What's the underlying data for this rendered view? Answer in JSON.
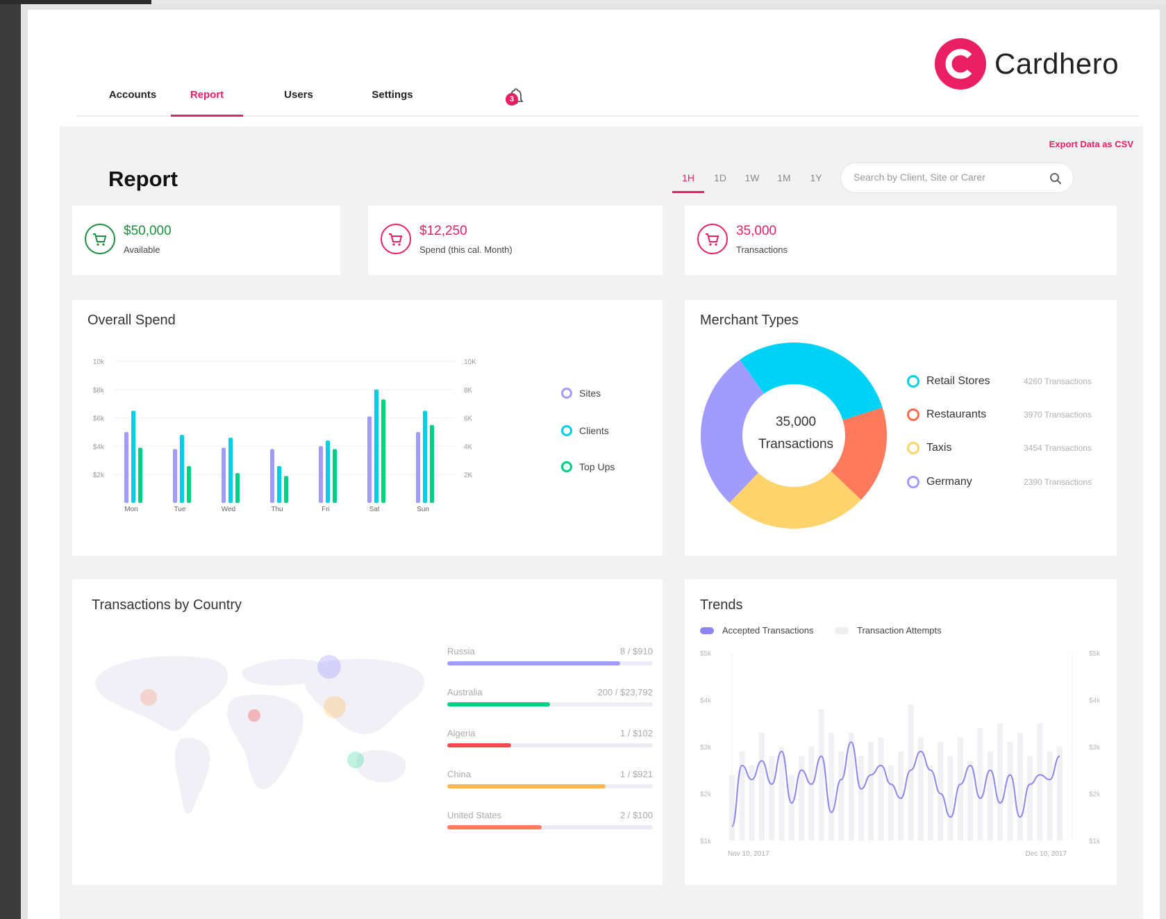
{
  "brand": {
    "name": "Cardhero",
    "accent": "#e91e63"
  },
  "nav": {
    "tabs": [
      {
        "label": "Accounts",
        "active": false
      },
      {
        "label": "Report",
        "active": true
      },
      {
        "label": "Users",
        "active": false
      },
      {
        "label": "Settings",
        "active": false
      }
    ],
    "notification_count": "3"
  },
  "page": {
    "title": "Report",
    "export_label": "Export Data as CSV",
    "timeframes": [
      {
        "label": "1H",
        "active": true
      },
      {
        "label": "1D",
        "active": false
      },
      {
        "label": "1W",
        "active": false
      },
      {
        "label": "1M",
        "active": false
      },
      {
        "label": "1Y",
        "active": false
      }
    ],
    "search_placeholder": "Search by Client, Site or Carer"
  },
  "stats": [
    {
      "value": "$50,000",
      "label": "Available",
      "color": "#1e8e3e",
      "icon": "cart-icon"
    },
    {
      "value": "$12,250",
      "label": "Spend (this cal. Month)",
      "color": "#e91e63",
      "icon": "cart-icon"
    },
    {
      "value": "35,000",
      "label": "Transactions",
      "color": "#e91e63",
      "icon": "cart-icon"
    }
  ],
  "overall_spend": {
    "title": "Overall Spend",
    "chart_data": {
      "type": "bar",
      "categories": [
        "Mon",
        "Tue",
        "Wed",
        "Thu",
        "Fri",
        "Sat",
        "Sun"
      ],
      "series": [
        {
          "name": "Sites",
          "color": "#a29bfe",
          "values": [
            5.0,
            3.8,
            3.9,
            3.8,
            4.0,
            6.1,
            5.0
          ]
        },
        {
          "name": "Clients",
          "color": "#00cfe8",
          "values": [
            6.5,
            4.8,
            4.6,
            2.6,
            4.4,
            8.0,
            6.5
          ]
        },
        {
          "name": "Top Ups",
          "color": "#00d084",
          "values": [
            3.9,
            2.6,
            2.1,
            1.9,
            3.8,
            7.3,
            5.5
          ]
        }
      ],
      "ylim": [
        0,
        10
      ],
      "y_ticks_left": [
        "$2k",
        "$4k",
        "$6k",
        "$8k",
        "10k"
      ],
      "y_ticks_right": [
        "2K",
        "4K",
        "6K",
        "8K",
        "10K"
      ],
      "grid": true
    }
  },
  "merchant_types": {
    "title": "Merchant Types",
    "center_value": "35,000",
    "center_label": "Transactions",
    "chart_data": {
      "type": "pie",
      "slices": [
        {
          "name": "Retail Stores",
          "color": "#00d2f5",
          "share": 0.3
        },
        {
          "name": "Restaurants",
          "color": "#ff7a5c",
          "share": 0.17
        },
        {
          "name": "Taxis",
          "color": "#ffd36b",
          "share": 0.25
        },
        {
          "name": "Germany",
          "color": "#a29bfe",
          "share": 0.28
        }
      ]
    },
    "legend": [
      {
        "name": "Retail Stores",
        "count": "4260 Transactions",
        "color": "#00cfe8"
      },
      {
        "name": "Restaurants",
        "count": "3970 Transactions",
        "color": "#ff6b4a"
      },
      {
        "name": "Taxis",
        "count": "3454 Transactions",
        "color": "#ffd36b"
      },
      {
        "name": "Germany",
        "count": "2390 Transactions",
        "color": "#a29bfe"
      }
    ]
  },
  "countries": {
    "title": "Transactions by Country",
    "rows": [
      {
        "name": "Russia",
        "value": "8 / $910",
        "fill": 0.84,
        "color": "#a29bfe"
      },
      {
        "name": "Australia",
        "value": "200 / $23,792",
        "fill": 0.5,
        "color": "#00d084"
      },
      {
        "name": "Algeria",
        "value": "1 / $102",
        "fill": 0.31,
        "color": "#f24b4b"
      },
      {
        "name": "China",
        "value": "1 / $921",
        "fill": 0.77,
        "color": "#ffb84d"
      },
      {
        "name": "United States",
        "value": "2 / $100",
        "fill": 0.46,
        "color": "#ff7a5c"
      }
    ]
  },
  "trends": {
    "title": "Trends",
    "legend": [
      {
        "name": "Accepted Transactions",
        "color": "#8c84f0"
      },
      {
        "name": "Transaction Attempts",
        "color": "#eeeeef"
      }
    ],
    "chart_data": {
      "type": "line",
      "x_labels": [
        "Nov 10, 2017",
        "Dec 10, 2017"
      ],
      "y_ticks": [
        "$1k",
        "$2k",
        "$3k",
        "$4k",
        "$5k"
      ],
      "ylim": [
        1,
        5
      ],
      "series": [
        {
          "name": "Accepted Transactions",
          "color": "#8c84f0",
          "values": [
            1.3,
            2.6,
            2.3,
            2.7,
            2.2,
            2.9,
            1.8,
            2.5,
            2.2,
            2.8,
            1.6,
            2.3,
            3.1,
            2.1,
            2.4,
            2.6,
            2.2,
            1.9,
            2.5,
            2.9,
            2.5,
            2.0,
            1.5,
            2.2,
            2.6,
            1.9,
            2.5,
            1.8,
            2.4,
            1.5,
            2.2,
            2.4,
            2.3,
            2.8
          ]
        },
        {
          "name": "Transaction Attempts",
          "color": "#eeeeef",
          "values": [
            2.4,
            2.9,
            2.6,
            3.3,
            2.8,
            3.0,
            2.4,
            2.8,
            3.0,
            3.8,
            3.3,
            2.9,
            3.3,
            2.8,
            3.1,
            3.2,
            2.6,
            2.9,
            3.9,
            3.2,
            2.6,
            3.1,
            2.8,
            3.2,
            2.7,
            3.4,
            2.9,
            3.5,
            3.1,
            3.3,
            2.8,
            3.5,
            2.9,
            3.0
          ]
        }
      ]
    }
  }
}
